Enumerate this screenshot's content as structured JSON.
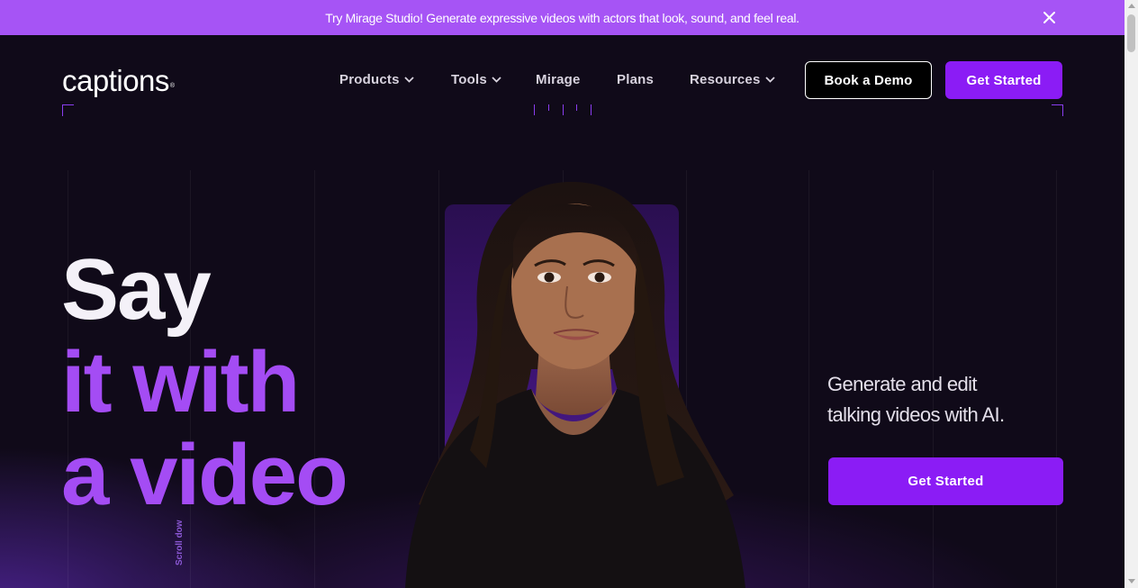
{
  "announcement": {
    "text": "Try Mirage Studio! Generate expressive videos with actors that look, sound, and feel real.",
    "close_icon": "close-icon"
  },
  "header": {
    "logo_text": "captions",
    "logo_mark": "®",
    "nav": [
      {
        "label": "Products",
        "has_dropdown": true
      },
      {
        "label": "Tools",
        "has_dropdown": true
      },
      {
        "label": "Mirage",
        "has_dropdown": false
      },
      {
        "label": "Plans",
        "has_dropdown": false
      },
      {
        "label": "Resources",
        "has_dropdown": true
      }
    ],
    "book_demo_label": "Book a Demo",
    "get_started_label": "Get Started"
  },
  "hero": {
    "headline_line1": "Say",
    "headline_line2": "it with",
    "headline_line3": "a video",
    "scroll_hint": "Scroll dow",
    "tagline_line1": "Generate and edit",
    "tagline_line2": "talking videos with AI.",
    "cta_label": "Get Started"
  },
  "colors": {
    "accent": "#8b1cf5",
    "announcement_bg": "#a654f5",
    "headline_purple": "#a44cf4",
    "background": "#100a19"
  }
}
